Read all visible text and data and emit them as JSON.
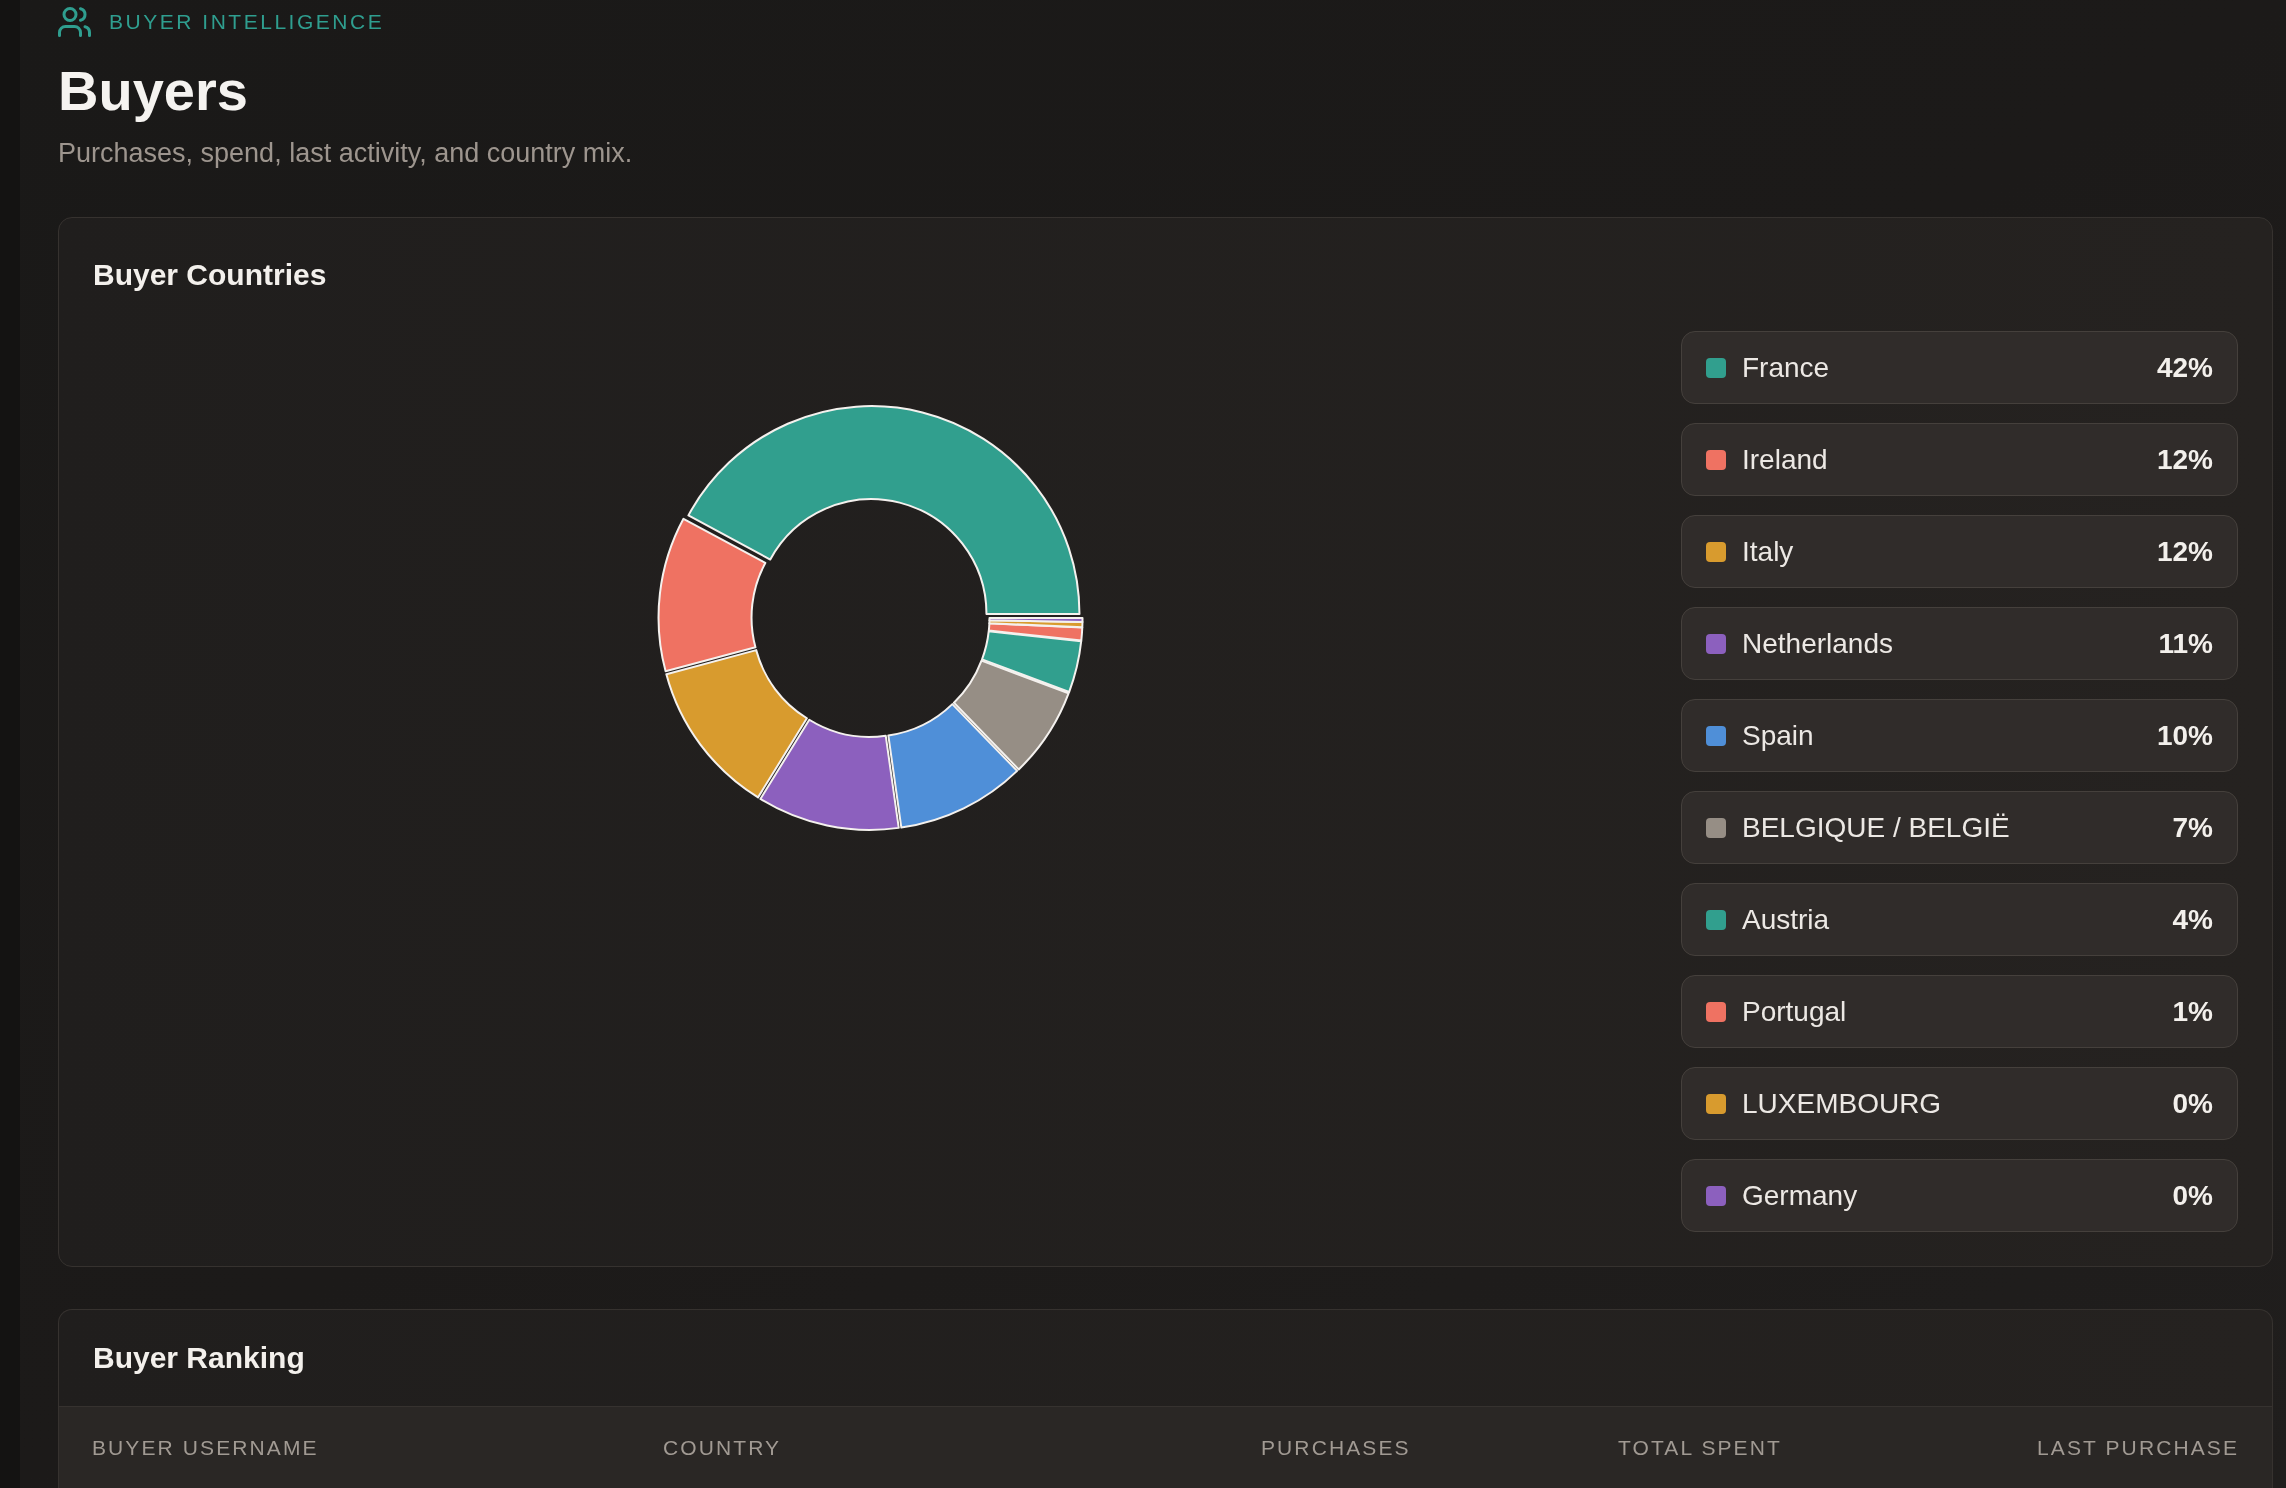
{
  "header": {
    "eyebrow": "BUYER INTELLIGENCE",
    "title": "Buyers",
    "subtitle": "Purchases, spend, last activity, and country mix."
  },
  "country_card": {
    "title": "Buyer Countries",
    "chart_data": {
      "type": "donut",
      "values": [
        42,
        12,
        12,
        11,
        10,
        7,
        4,
        1,
        0.4,
        0.3
      ]
    },
    "legend": [
      {
        "label": "France",
        "value": "42%",
        "color": "#319f8e"
      },
      {
        "label": "Ireland",
        "value": "12%",
        "color": "#ef7262"
      },
      {
        "label": "Italy",
        "value": "12%",
        "color": "#d89b2e"
      },
      {
        "label": "Netherlands",
        "value": "11%",
        "color": "#8c60be"
      },
      {
        "label": "Spain",
        "value": "10%",
        "color": "#4f8fd8"
      },
      {
        "label": "BELGIQUE / BELGIË",
        "value": "7%",
        "color": "#968e85"
      },
      {
        "label": "Austria",
        "value": "4%",
        "color": "#319f8e"
      },
      {
        "label": "Portugal",
        "value": "1%",
        "color": "#ef7262"
      },
      {
        "label": "LUXEMBOURG",
        "value": "0%",
        "color": "#d89b2e"
      },
      {
        "label": "Germany",
        "value": "0%",
        "color": "#8c60be"
      }
    ]
  },
  "ranking_card": {
    "title": "Buyer Ranking",
    "table": {
      "columns": [
        "BUYER USERNAME",
        "COUNTRY",
        "PURCHASES",
        "TOTAL SPENT",
        "LAST PURCHASE"
      ]
    }
  }
}
